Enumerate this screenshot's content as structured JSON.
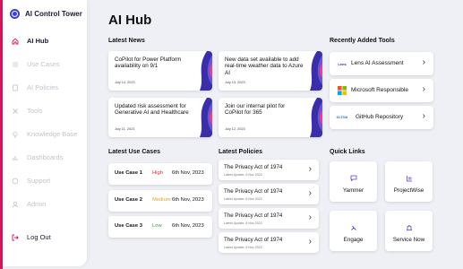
{
  "sidebar": {
    "brand": "AI Control Tower",
    "items": [
      {
        "label": "AI Hub",
        "icon": "home-icon"
      },
      {
        "label": "Use Cases",
        "icon": "list-icon"
      },
      {
        "label": "AI Policies",
        "icon": "document-icon"
      },
      {
        "label": "Tools",
        "icon": "tools-icon"
      },
      {
        "label": "Knowledge Base",
        "icon": "lightbulb-icon"
      },
      {
        "label": "Dashboards",
        "icon": "bar-chart-icon"
      },
      {
        "label": "Support",
        "icon": "help-icon"
      },
      {
        "label": "Admin",
        "icon": "admin-icon"
      }
    ],
    "logout": "Log Out"
  },
  "page_title": "AI Hub",
  "sections": {
    "latest_news": "Latest News",
    "recently_added_tools": "Recently Added Tools",
    "latest_use_cases": "Latest Use Cases",
    "latest_policies": "Latest Policies",
    "quick_links": "Quick Links"
  },
  "news": [
    {
      "title": "CoPilot for Power Platform availability on 9/1",
      "date": "July 14, 2023"
    },
    {
      "title": "New data set available to add real-time weather data to Azure AI",
      "date": "July 13, 2023"
    },
    {
      "title": "Updated risk assessment for Generative AI and Healthcare",
      "date": "July 11, 2023"
    },
    {
      "title": "Join our internal pilot for CoPilot for 365",
      "date": "July 12, 2023"
    }
  ],
  "tools": [
    {
      "name": "Lens AI Assessment",
      "logo_text": "Lens"
    },
    {
      "name": "Microsoft Responsible",
      "logo_text": ""
    },
    {
      "name": "GitHub Repository",
      "logo_text": "OLTIVA"
    }
  ],
  "use_cases": [
    {
      "name": "Use Case 1",
      "level": "High",
      "date": "6th Nov, 2023",
      "level_color": "#e0283a"
    },
    {
      "name": "Use Case 2",
      "level": "Medium",
      "date": "6th Nov, 2023",
      "level_color": "#e8a317"
    },
    {
      "name": "Use Case 3",
      "level": "Low",
      "date": "6th Nov, 2023",
      "level_color": "#2aa64a"
    }
  ],
  "policies": [
    {
      "title": "The Privacy Act of 1974",
      "updated": "Latest Update: 6 Nov 2023"
    },
    {
      "title": "The Privacy Act of 1974",
      "updated": "Latest Update: 6 Nov 2023"
    },
    {
      "title": "The Privacy Act of 1974",
      "updated": "Latest Update: 6 Nov 2023"
    },
    {
      "title": "The Privacy Act of 1974",
      "updated": "Latest Update: 6 Nov 2023"
    }
  ],
  "quick_links": [
    {
      "label": "Yammer",
      "icon": "chat-icon"
    },
    {
      "label": "ProjectWise",
      "icon": "project-icon"
    },
    {
      "label": "Engage",
      "icon": "engage-icon"
    },
    {
      "label": "Service Now",
      "icon": "service-icon"
    }
  ],
  "colors": {
    "accent": "#d4145a",
    "brand": "#3a3fd8",
    "high": "#e0283a",
    "medium": "#e8a317",
    "low": "#2aa64a"
  }
}
